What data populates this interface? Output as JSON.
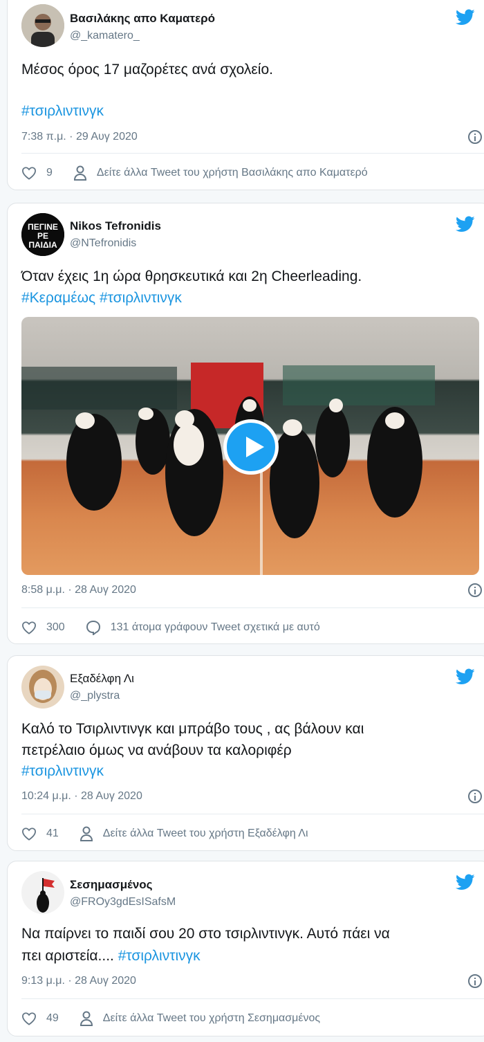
{
  "tweets": [
    {
      "name": "Βασιλάκης απο Καματερό",
      "handle": "@_kamatero_",
      "text_lines": [
        "Μέσος όρος 17 μαζορέτες ανά σχολείο."
      ],
      "hashtags": "#τσιρλιντινγκ",
      "time": "7:38 π.μ. · 29 Αυγ 2020",
      "likes": "9",
      "secondary_action": "Δείτε άλλα Tweet του χρήστη Βασιλάκης απο Καματερό"
    },
    {
      "name": "Nikos Tefronidis",
      "handle": "@NTefronidis",
      "text_line1": "Όταν έχεις 1η ώρα θρησκευτικά και 2η Cheerleading.",
      "hashtags": "#Κεραμέως #τσιρλιντινγκ",
      "avatar_text": "ΠΕΓΙΝΕ ΡΕ ΠΑΙΔΙΑ",
      "time": "8:58 μ.μ. · 28 Αυγ 2020",
      "likes": "300",
      "secondary_action": "131 άτομα γράφουν Tweet σχετικά με αυτό"
    },
    {
      "name": "Εξαδέλφη Λι",
      "handle": "@_plystra",
      "text_line1": "Καλό το Τσιρλιντινγκ και μπράβο τους , ας βάλουν και",
      "text_line2": "πετρέλαιο όμως να ανάβουν τα καλοριφέρ",
      "hashtags": "#τσιρλιντινγκ",
      "time": "10:24 μ.μ. · 28 Αυγ 2020",
      "likes": "41",
      "secondary_action": "Δείτε άλλα Tweet του χρήστη Εξαδέλφη Λι"
    },
    {
      "name": "Σεσημασμένος",
      "handle": "@FROy3gdEsISafsM",
      "text_line1": "Να παίρνει το παιδί σου 20 στο τσιρλιντινγκ. Αυτό πάει να",
      "text_line2_prefix": "πει αριστεία.... ",
      "hashtags": "#τσιρλιντινγκ",
      "time": "9:13 μ.μ. · 28 Αυγ 2020",
      "likes": "49",
      "secondary_action": "Δείτε άλλα Tweet του χρήστη Σεσημασμένος"
    }
  ],
  "colors": {
    "link": "#1b95e0",
    "twitter_blue": "#1da1f2",
    "muted": "#657786"
  }
}
